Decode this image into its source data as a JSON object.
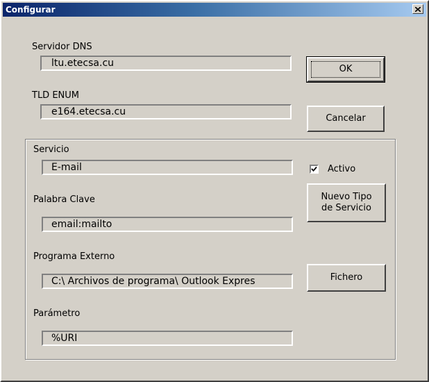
{
  "window": {
    "title": "Configurar"
  },
  "dns": {
    "label": "Servidor DNS",
    "value": "ltu.etecsa.cu"
  },
  "tld": {
    "label": "TLD ENUM",
    "value": "e164.etecsa.cu"
  },
  "buttons": {
    "ok": "OK",
    "cancel": "Cancelar",
    "new_type_line1": "Nuevo Tipo",
    "new_type_line2": "de Servicio",
    "file": "Fichero"
  },
  "service": {
    "label": "Servicio",
    "value": "E-mail",
    "active_label": "Activo",
    "active_checked": true
  },
  "keyword": {
    "label": "Palabra Clave",
    "value": "email:mailto"
  },
  "program": {
    "label": "Programa Externo",
    "value": "C:\\ Archivos de programa\\ Outlook Expres"
  },
  "parameter": {
    "label": "Parámetro",
    "value": "%URI"
  },
  "icons": {
    "close": "close-icon",
    "check": "check-icon"
  }
}
